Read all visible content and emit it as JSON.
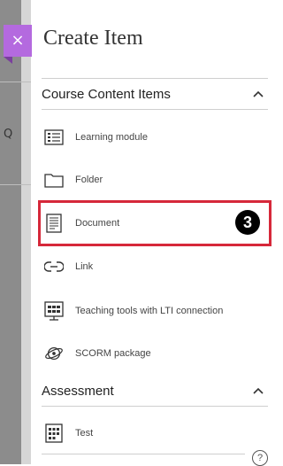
{
  "panel": {
    "title": "Create Item",
    "close_label": "×"
  },
  "sections": {
    "course_content": {
      "label": "Course Content Items",
      "items": [
        {
          "label": "Learning module",
          "icon": "learning-module-icon"
        },
        {
          "label": "Folder",
          "icon": "folder-icon"
        },
        {
          "label": "Document",
          "icon": "document-icon"
        },
        {
          "label": "Link",
          "icon": "link-icon"
        },
        {
          "label": "Teaching tools with LTI connection",
          "icon": "lti-tool-icon"
        },
        {
          "label": "SCORM package",
          "icon": "scorm-icon"
        }
      ]
    },
    "assessment": {
      "label": "Assessment",
      "items": [
        {
          "label": "Test",
          "icon": "test-icon"
        }
      ]
    }
  },
  "annotation": {
    "badge_number": "3",
    "highlight_color": "#d6283a"
  },
  "backdrop": {
    "search_glyph": "Q"
  },
  "help": {
    "label": "?"
  },
  "colors": {
    "accent": "#b46adf",
    "backdrop": "#8c8c8c"
  }
}
